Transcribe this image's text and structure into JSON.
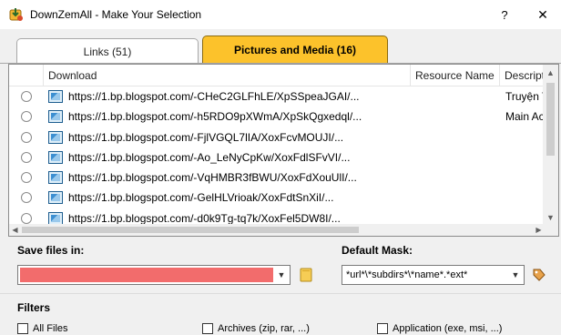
{
  "window": {
    "title": "DownZemAll - Make Your Selection",
    "help_label": "?",
    "close_label": "✕"
  },
  "tabs": [
    {
      "label": "Links (51)",
      "active": false
    },
    {
      "label": "Pictures and Media (16)",
      "active": true
    }
  ],
  "colors": {
    "active_tab": "#fcc22b",
    "save_field_highlight": "#f26c6c",
    "title_bar": "#ffffff",
    "background": "#f0f0f0"
  },
  "list": {
    "columns": [
      "Download",
      "Resource Name",
      "Descript"
    ],
    "rows": [
      {
        "url": "https://1.bp.blogspot.com/-CHeC2GLFhLE/XpSSpeaJGAI/...",
        "description": "Truyện T",
        "icon": "image-file-icon"
      },
      {
        "url": "https://1.bp.blogspot.com/-h5RDO9pXWmA/XpSkQgxedql/...",
        "description": "Main Ac",
        "icon": "image-file-icon"
      },
      {
        "url": "https://1.bp.blogspot.com/-FjlVGQL7lIA/XoxFcvMOUJI/...",
        "description": "",
        "icon": "image-file-icon"
      },
      {
        "url": "https://1.bp.blogspot.com/-Ao_LeNyCpKw/XoxFdlSFvVI/...",
        "description": "",
        "icon": "image-file-icon"
      },
      {
        "url": "https://1.bp.blogspot.com/-VqHMBR3fBWU/XoxFdXouUlI/...",
        "description": "",
        "icon": "image-file-icon"
      },
      {
        "url": "https://1.bp.blogspot.com/-GelHLVrioak/XoxFdtSnXiI/...",
        "description": "",
        "icon": "image-file-icon"
      },
      {
        "url": "https://1.bp.blogspot.com/-d0k9Tg-tq7k/XoxFel5DW8I/...",
        "description": "",
        "icon": "image-file-icon"
      }
    ]
  },
  "save": {
    "label": "Save files in:",
    "value": ""
  },
  "mask": {
    "label": "Default Mask:",
    "value": "*url*\\*subdirs*\\*name*.*ext*"
  },
  "filters": {
    "label": "Filters",
    "items": [
      "All Files",
      "Archives (zip, rar, ...)",
      "Application (exe, msi, ...)"
    ]
  }
}
